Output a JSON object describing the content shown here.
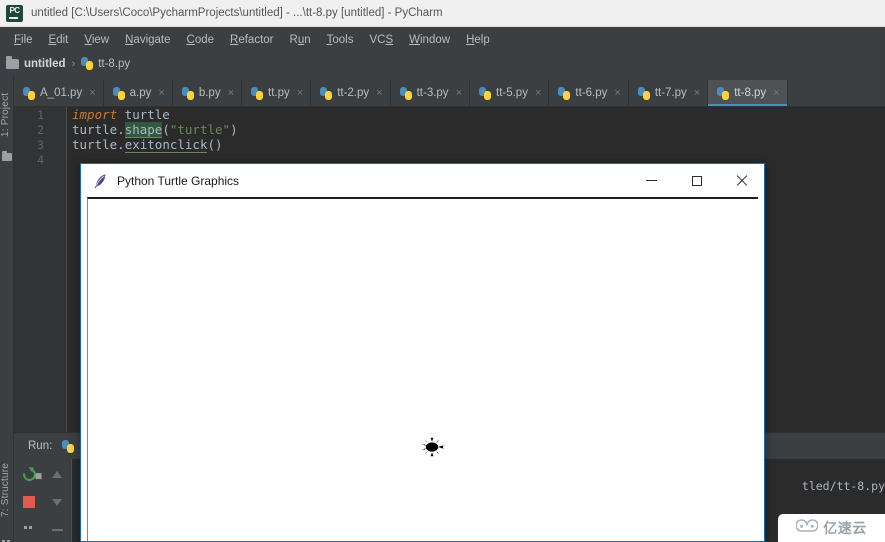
{
  "window": {
    "title": "untitled [C:\\Users\\Coco\\PycharmProjects\\untitled] - ...\\tt-8.py [untitled] - PyCharm",
    "app_icon": "pycharm-logo-icon",
    "logo_text": "PC"
  },
  "menubar": {
    "items": [
      {
        "label": "File",
        "mnemonic": "F"
      },
      {
        "label": "Edit",
        "mnemonic": "E"
      },
      {
        "label": "View",
        "mnemonic": "V"
      },
      {
        "label": "Navigate",
        "mnemonic": "N"
      },
      {
        "label": "Code",
        "mnemonic": "C"
      },
      {
        "label": "Refactor",
        "mnemonic": "R"
      },
      {
        "label": "Run",
        "mnemonic": "u"
      },
      {
        "label": "Tools",
        "mnemonic": "T"
      },
      {
        "label": "VCS",
        "mnemonic": "S"
      },
      {
        "label": "Window",
        "mnemonic": "W"
      },
      {
        "label": "Help",
        "mnemonic": "H"
      }
    ]
  },
  "breadcrumb": {
    "project": "untitled",
    "separator": "›",
    "file": "tt-8.py"
  },
  "tabs": {
    "close_glyph": "×",
    "items": [
      {
        "label": "A_01.py",
        "active": false
      },
      {
        "label": "a.py",
        "active": false
      },
      {
        "label": "b.py",
        "active": false
      },
      {
        "label": "tt.py",
        "active": false
      },
      {
        "label": "tt-2.py",
        "active": false
      },
      {
        "label": "tt-3.py",
        "active": false
      },
      {
        "label": "tt-5.py",
        "active": false
      },
      {
        "label": "tt-6.py",
        "active": false
      },
      {
        "label": "tt-7.py",
        "active": false
      },
      {
        "label": "tt-8.py",
        "active": true
      }
    ]
  },
  "left_toolstrip": {
    "project_label": "1: Project",
    "structure_label": "7: Structure"
  },
  "editor": {
    "line_numbers": [
      "1",
      "2",
      "3",
      "4"
    ],
    "lines": [
      {
        "n": 1,
        "tokens": [
          {
            "t": "import",
            "c": "kw"
          },
          {
            "t": " turtle",
            "c": "plain"
          }
        ]
      },
      {
        "n": 2,
        "tokens": [
          {
            "t": "turtle.",
            "c": "plain"
          },
          {
            "t": "shape",
            "c": "fn-hl"
          },
          {
            "t": "(",
            "c": "plain"
          },
          {
            "t": "\"turtle\"",
            "c": "str"
          },
          {
            "t": ")",
            "c": "plain"
          }
        ]
      },
      {
        "n": 3,
        "tokens": [
          {
            "t": "turtle.",
            "c": "plain"
          },
          {
            "t": "exitonclick",
            "c": "fn"
          },
          {
            "t": "()",
            "c": "plain"
          }
        ]
      },
      {
        "n": 4,
        "tokens": []
      }
    ],
    "plain_text": "import turtle\nturtle.shape(\"turtle\")\nturtle.exitonclick()\n"
  },
  "run_panel": {
    "label": "Run:",
    "config_icon": "python-config-icon",
    "buttons": [
      {
        "name": "rerun-button",
        "icon": "rerun-icon"
      },
      {
        "name": "stop-button",
        "icon": "stop-square-icon"
      },
      {
        "name": "scroll-up-button",
        "icon": "arrow-up-icon"
      },
      {
        "name": "scroll-down-button",
        "icon": "arrow-down-icon"
      },
      {
        "name": "soft-wrap-button",
        "icon": "grid-icon"
      },
      {
        "name": "print-button",
        "icon": "dash-icon"
      }
    ],
    "console_line": "tled/tt-8.py"
  },
  "turtle_window": {
    "title": "Python Turtle Graphics",
    "icon": "quill-feather-icon",
    "controls": {
      "minimize": "minimize-icon",
      "maximize": "maximize-icon",
      "close": "close-icon"
    },
    "canvas": {
      "background": "#ffffff",
      "turtle_color": "#000000",
      "turtle_shape": "turtle"
    }
  },
  "watermark": {
    "text": "亿速云",
    "logo": "cloud-logo-icon"
  },
  "colors": {
    "ide_chrome": "#3c3f41",
    "editor_bg": "#2b2b2b",
    "gutter_bg": "#313335",
    "accent_blue": "#4a88c7",
    "keyword_orange": "#cc7832",
    "string_green": "#6a8759",
    "text_gray": "#a9b7c6",
    "stop_red": "#e05a4f",
    "run_green": "#48a148",
    "window_border_blue": "#1d6bab"
  }
}
